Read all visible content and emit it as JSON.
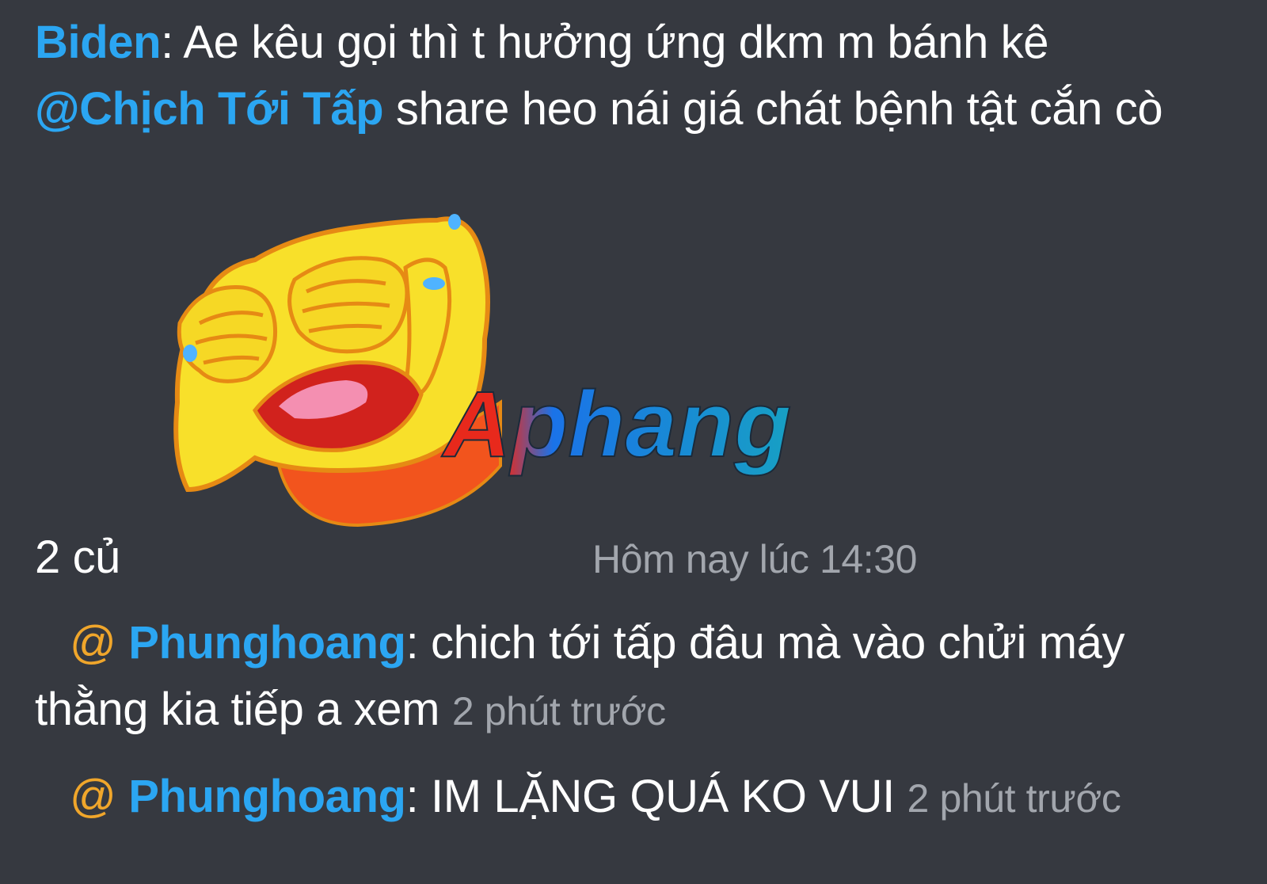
{
  "messages": [
    {
      "user": "Biden",
      "separator": ": ",
      "line1_text": "Ae kêu gọi thì t hưởng ứng dkm m bánh kê",
      "mention": "@Chịch Tới Tấp",
      "line2_text": " share heo nái giá chát bệnh tật cắn cò"
    },
    {
      "text": "2 củ",
      "time": "Hôm nay lúc 14:30"
    },
    {
      "at": "@",
      "user": "Phunghoang",
      "separator": ": ",
      "line1_text": "chich tới tấp đâu mà vào chửi máy",
      "line2_text": "thằng kia tiếp a xem",
      "time": "2 phút trước"
    },
    {
      "at": "@",
      "user": "Phunghoang",
      "separator": ": ",
      "text": "IM LẶNG QUÁ KO VUI",
      "time": "2 phút trước"
    }
  ],
  "watermark": {
    "text": "Aphang",
    "colors": [
      "#e8291c",
      "#1a73e8",
      "#17a0c4"
    ]
  },
  "sticker": {
    "icon": "laughing-crying-face-sticker",
    "colors": {
      "face": "#f8e02a",
      "outline": "#e68a14",
      "mouth": "#d1221d",
      "tongue": "#f48fb1",
      "tears": "#4fb3ff",
      "shirt": "#f2541d"
    }
  },
  "theme": {
    "background": "#363940",
    "username": "#2ba6f2",
    "at_symbol": "#f0a62b",
    "timestamp": "#a2a6ad"
  }
}
